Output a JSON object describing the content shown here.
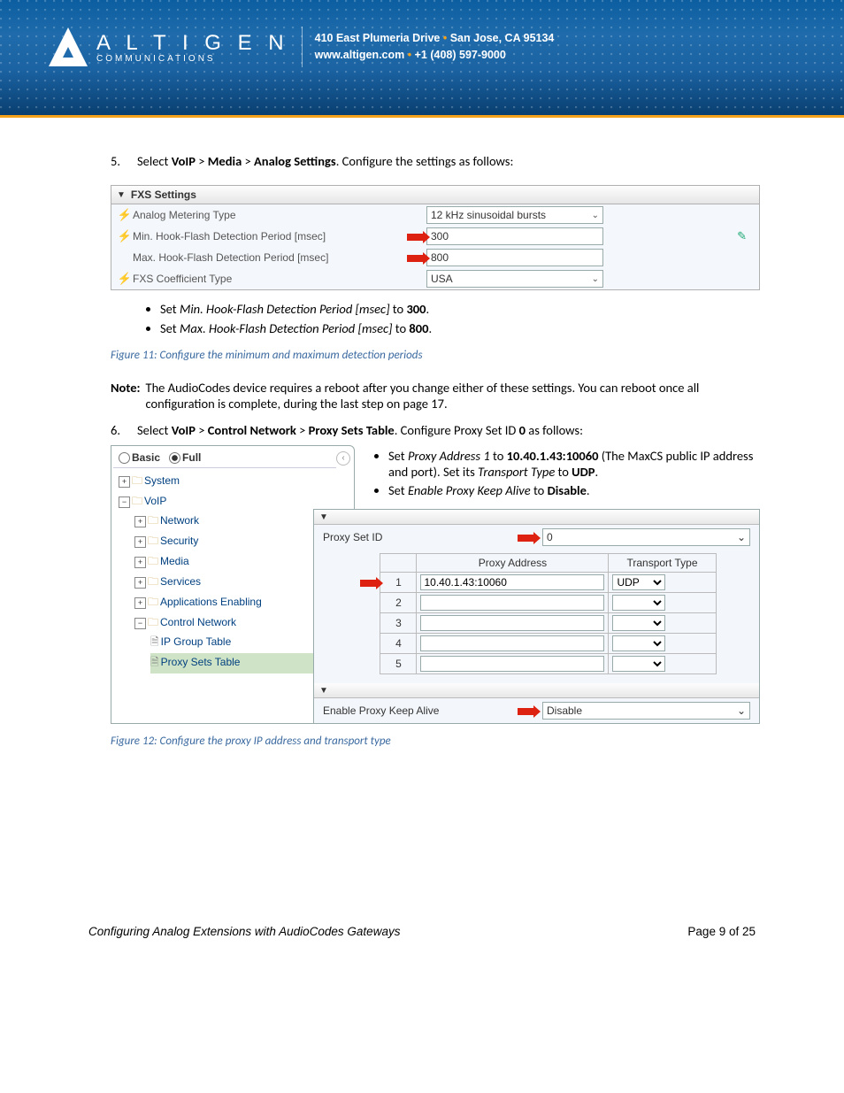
{
  "header": {
    "brand_main": "A L T I G E N",
    "brand_sub": "COMMUNICATIONS",
    "addr": "410 East Plumeria Drive",
    "city": "San Jose, CA 95134",
    "web": "www.altigen.com",
    "phone": "+1 (408) 597-9000"
  },
  "step5": {
    "num": "5.",
    "pre": "Select ",
    "bc1": "VoIP",
    "bc2": "Media",
    "bc3": "Analog Settings",
    "post": ".  Configure the settings as follows:"
  },
  "fxs": {
    "title": "FXS Settings",
    "r1_label": "Analog Metering Type",
    "r1_value": "12 kHz sinusoidal bursts",
    "r2_label": "Min. Hook-Flash Detection Period [msec]",
    "r2_value": "300",
    "r3_label": "Max. Hook-Flash Detection Period [msec]",
    "r3_value": "800",
    "r4_label": "FXS Coefficient Type",
    "r4_value": "USA"
  },
  "b1": {
    "a": "Set ",
    "i": "Min. Hook-Flash Detection Period [msec]",
    "b": " to ",
    "v": "300",
    "c": "."
  },
  "b2": {
    "a": "Set ",
    "i": "Max. Hook-Flash Detection Period [msec]",
    "b": " to ",
    "v": "800",
    "c": "."
  },
  "fig11": "Figure 11: Configure the minimum and maximum detection periods",
  "note": {
    "label": "Note:",
    "text": "The AudioCodes device requires a reboot after you change either of these settings. You can reboot once all configuration is complete, during the last step on page 17."
  },
  "step6": {
    "num": "6.",
    "pre": "Select ",
    "bc1": "VoIP",
    "bc2": "Control Network",
    "bc3": "Proxy Sets Table",
    "mid": ".  Configure Proxy Set ID ",
    "id": "0",
    "post": " as follows:"
  },
  "tree": {
    "basic": "Basic",
    "full": "Full",
    "system": "System",
    "voip": "VoIP",
    "network": "Network",
    "security": "Security",
    "media": "Media",
    "services": "Services",
    "apps": "Applications Enabling",
    "ctrl": "Control Network",
    "ipg": "IP Group Table",
    "pst": "Proxy Sets Table"
  },
  "pb1": {
    "a": "Set ",
    "i1": "Proxy Address 1",
    "b": " to ",
    "v": "10.40.1.43:10060",
    "c": " (The MaxCS public IP address and port). Set its ",
    "i2": "Transport Type",
    "d": " to ",
    "v2": "UDP",
    "e": "."
  },
  "pb2": {
    "a": "Set ",
    "i": "Enable Proxy Keep Alive",
    "b": " to ",
    "v": "Disable",
    "c": "."
  },
  "cfg": {
    "psid_label": "Proxy Set ID",
    "psid_value": "0",
    "col_addr": "Proxy Address",
    "col_tt": "Transport Type",
    "row1": "1",
    "row2": "2",
    "row3": "3",
    "row4": "4",
    "row5": "5",
    "addr1": "10.40.1.43:10060",
    "tt1": "UDP",
    "epka_label": "Enable Proxy Keep Alive",
    "epka_value": "Disable"
  },
  "fig12": "Figure 12: Configure the proxy IP address and transport type",
  "footer": {
    "title": "Configuring Analog Extensions with AudioCodes Gateways",
    "page": "Page 9 of 25"
  }
}
